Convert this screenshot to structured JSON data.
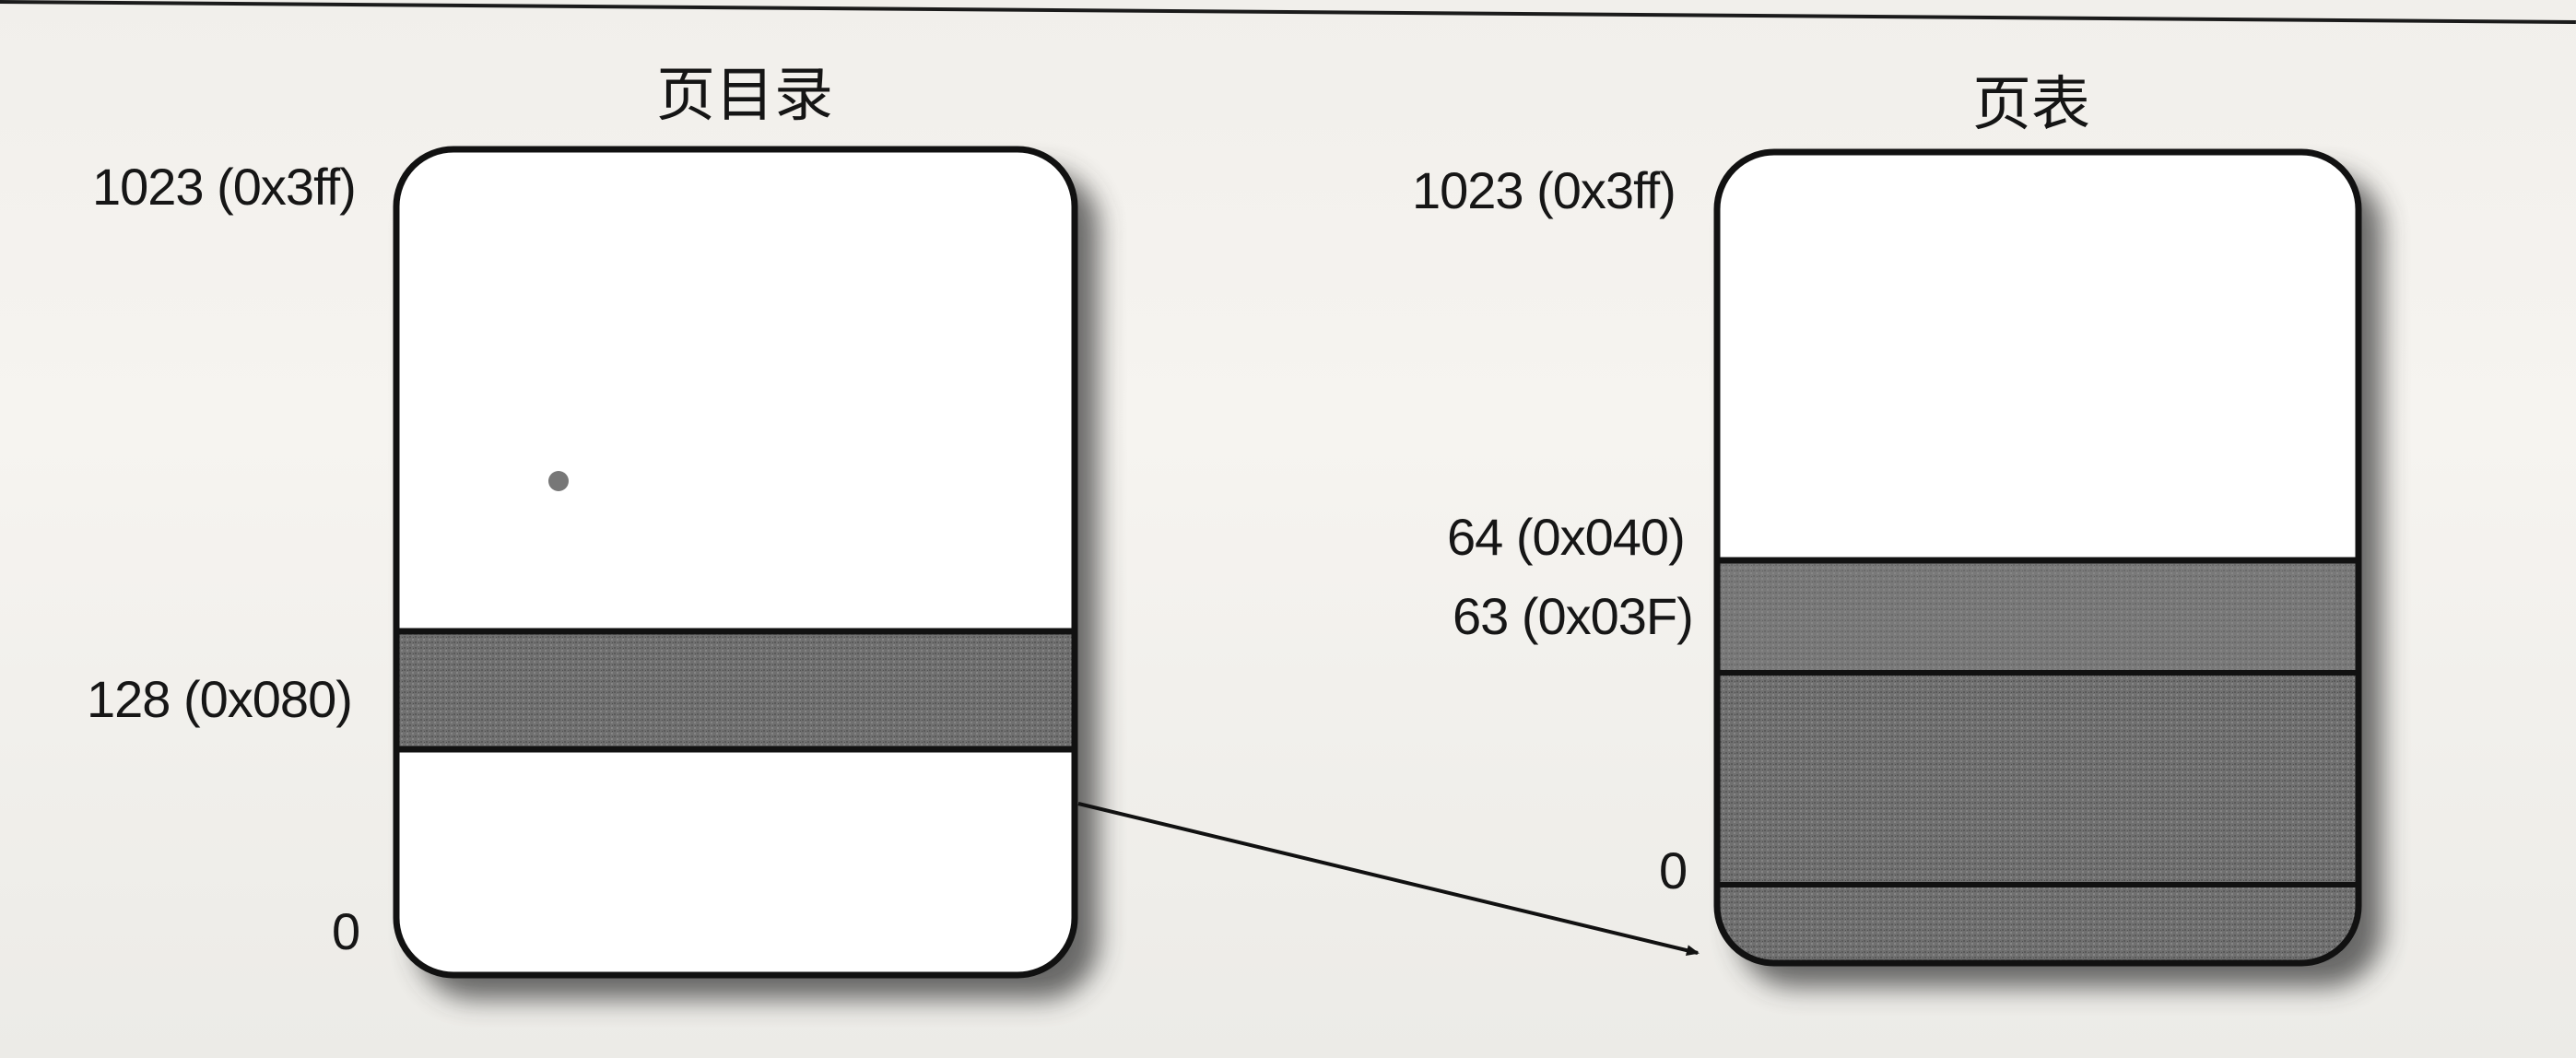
{
  "page_directory": {
    "title": "页目录",
    "labels": {
      "top": "1023 (0x3ff)",
      "entry": "128 (0x080)",
      "bottom": "0"
    }
  },
  "page_table": {
    "title": "页表",
    "labels": {
      "top": "1023 (0x3ff)",
      "boundary_upper": "64 (0x040)",
      "boundary_lower": "63 (0x03F)",
      "bottom": "0"
    }
  },
  "colors": {
    "outline": "#111111",
    "shaded_region": "#6f6f6f",
    "box_fill": "#ffffff",
    "shadow": "#3a3a3a"
  },
  "arrow": {
    "from": "page_directory.entry",
    "to": "page_table.bottom"
  }
}
